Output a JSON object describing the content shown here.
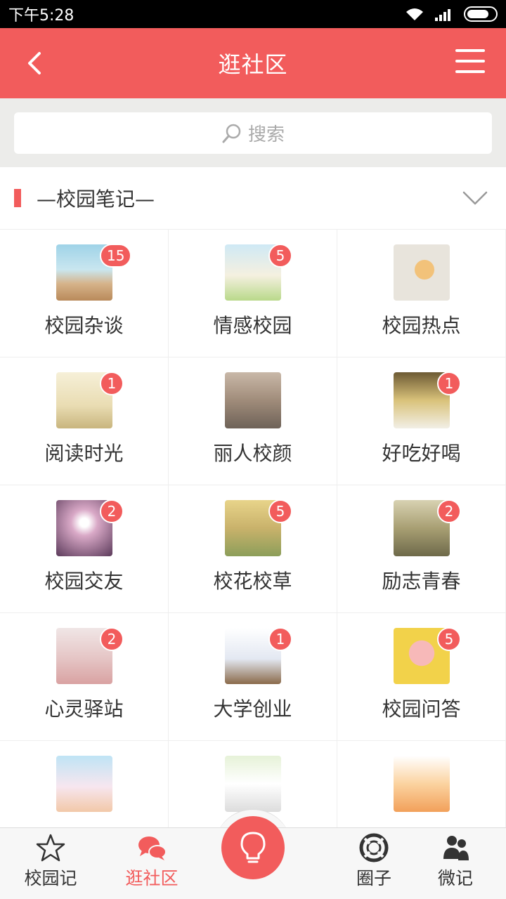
{
  "status_bar": {
    "time": "下午5:28"
  },
  "header": {
    "title": "逛社区"
  },
  "search": {
    "placeholder": "搜索"
  },
  "section": {
    "title": "—校园笔记—"
  },
  "grid": [
    {
      "label": "校园杂谈",
      "badge": "15",
      "theme": "crowd"
    },
    {
      "label": "情感校园",
      "badge": "5",
      "theme": "couple"
    },
    {
      "label": "校园热点",
      "badge": "",
      "theme": "cartoon"
    },
    {
      "label": "阅读时光",
      "badge": "1",
      "theme": "book"
    },
    {
      "label": "丽人校颜",
      "badge": "",
      "theme": "people"
    },
    {
      "label": "好吃好喝",
      "badge": "1",
      "theme": "food"
    },
    {
      "label": "校园交友",
      "badge": "2",
      "theme": "light"
    },
    {
      "label": "校花校草",
      "badge": "5",
      "theme": "flowers"
    },
    {
      "label": "励志青春",
      "badge": "2",
      "theme": "swing"
    },
    {
      "label": "心灵驿站",
      "badge": "2",
      "theme": "hands"
    },
    {
      "label": "大学创业",
      "badge": "1",
      "theme": "business"
    },
    {
      "label": "校园问答",
      "badge": "5",
      "theme": "pink"
    },
    {
      "label": "",
      "badge": "",
      "theme": "date"
    },
    {
      "label": "",
      "badge": "",
      "theme": "openbook"
    },
    {
      "label": "",
      "badge": "",
      "theme": "vote"
    }
  ],
  "tabs": [
    {
      "label": "校园记",
      "icon": "star-icon",
      "active": false
    },
    {
      "label": "逛社区",
      "icon": "chat-icon",
      "active": true
    },
    {
      "label": "",
      "icon": "lightbulb-icon",
      "active": false
    },
    {
      "label": "圈子",
      "icon": "lifebuoy-icon",
      "active": false
    },
    {
      "label": "微记",
      "icon": "users-icon",
      "active": false
    }
  ],
  "colors": {
    "accent": "#f25c5c",
    "background": "#ececea"
  }
}
